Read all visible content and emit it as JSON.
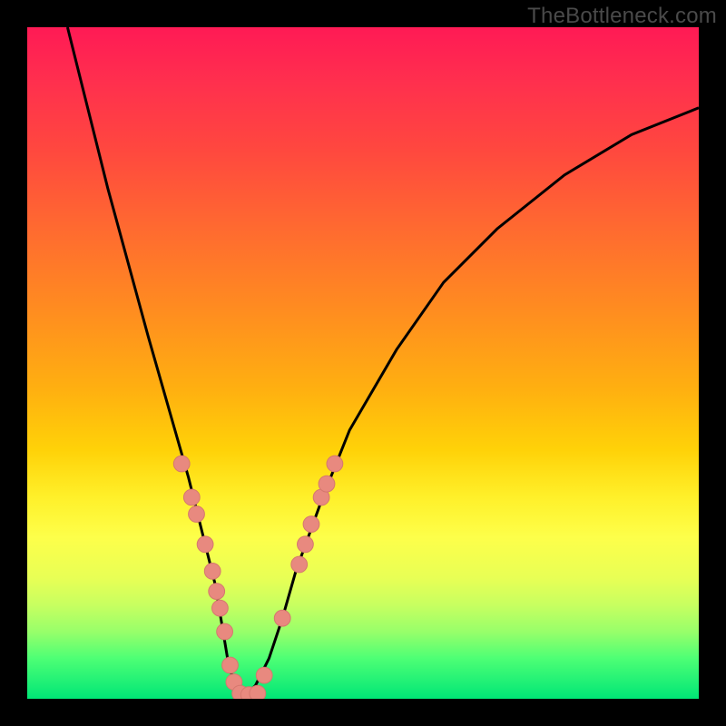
{
  "source_label": "TheBottleneck.com",
  "colors": {
    "curve_stroke": "#000000",
    "marker_fill": "#e8897f",
    "marker_stroke": "#d5786e",
    "gradient_top": "#ff1a55",
    "gradient_bottom": "#00e676"
  },
  "chart_data": {
    "type": "line",
    "title": "",
    "xlabel": "",
    "ylabel": "",
    "xlim": [
      0,
      100
    ],
    "ylim": [
      0,
      100
    ],
    "grid": false,
    "note": "Axes have no tick labels in the image; x/y values are estimated positions in percent of plot area. y increases upward (0 = bottom/green, 100 = top/red).",
    "series": [
      {
        "name": "bottleneck-curve",
        "color": "#000000",
        "x": [
          6,
          8,
          10,
          12,
          15,
          18,
          20,
          22,
          24,
          26,
          28,
          29,
          30,
          31,
          32,
          34,
          36,
          38,
          40,
          44,
          48,
          55,
          62,
          70,
          80,
          90,
          100
        ],
        "y": [
          100,
          92,
          84,
          76,
          65,
          54,
          47,
          40,
          33,
          25,
          17,
          11,
          5,
          2,
          0,
          2,
          6,
          12,
          19,
          30,
          40,
          52,
          62,
          70,
          78,
          84,
          88
        ]
      }
    ],
    "markers": {
      "name": "highlighted-points",
      "color": "#e8897f",
      "radius_pct": 1.2,
      "points": [
        {
          "x": 23.0,
          "y": 35.0
        },
        {
          "x": 24.5,
          "y": 30.0
        },
        {
          "x": 25.2,
          "y": 27.5
        },
        {
          "x": 26.5,
          "y": 23.0
        },
        {
          "x": 27.6,
          "y": 19.0
        },
        {
          "x": 28.2,
          "y": 16.0
        },
        {
          "x": 28.7,
          "y": 13.5
        },
        {
          "x": 29.4,
          "y": 10.0
        },
        {
          "x": 30.2,
          "y": 5.0
        },
        {
          "x": 30.8,
          "y": 2.5
        },
        {
          "x": 31.7,
          "y": 0.8
        },
        {
          "x": 33.0,
          "y": 0.6
        },
        {
          "x": 34.3,
          "y": 0.8
        },
        {
          "x": 35.3,
          "y": 3.5
        },
        {
          "x": 38.0,
          "y": 12.0
        },
        {
          "x": 40.5,
          "y": 20.0
        },
        {
          "x": 41.4,
          "y": 23.0
        },
        {
          "x": 42.3,
          "y": 26.0
        },
        {
          "x": 43.8,
          "y": 30.0
        },
        {
          "x": 44.6,
          "y": 32.0
        },
        {
          "x": 45.8,
          "y": 35.0
        }
      ]
    }
  }
}
